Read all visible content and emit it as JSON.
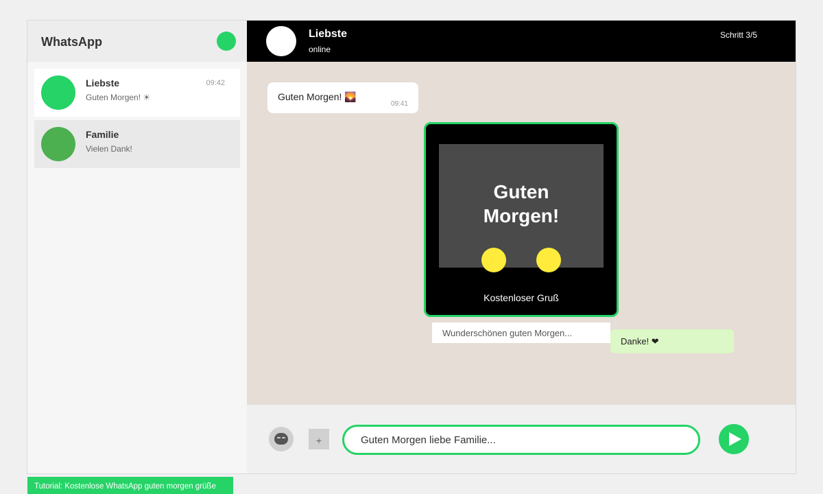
{
  "colors": {
    "accent": "#25d366",
    "header_bg": "#000000",
    "chat_bg": "#e5ddd6",
    "outgoing_bubble": "#dcf8c6",
    "card_inner": "#4a4a4a",
    "dot": "#ffeb3b",
    "avatar_familie": "#4caf50"
  },
  "sidebar": {
    "title": "WhatsApp",
    "chats": [
      {
        "name": "Liebste",
        "preview": "Guten Morgen! ☀",
        "time": "09:42",
        "avatar_color": "#25d366"
      },
      {
        "name": "Familie",
        "preview": "Vielen Dank!",
        "time": "",
        "avatar_color": "#4caf50"
      }
    ]
  },
  "header": {
    "name": "Liebste",
    "status": "online",
    "step": "Schritt 3/5"
  },
  "messages": {
    "incoming": {
      "text": "Guten Morgen! 🌄",
      "time": "09:41"
    },
    "card": {
      "title_line1": "Guten",
      "title_line2": "Morgen!",
      "caption": "Kostenloser Gruß"
    },
    "card_caption_text": "Wunderschönen guten Morgen...",
    "outgoing": "Danke! ❤"
  },
  "composer": {
    "value": "Guten Morgen liebe Familie...",
    "attach_label": "+",
    "emoji_icon": "emoji-icon",
    "send_icon": "send-icon"
  },
  "footer": {
    "tutorial": "Tutorial: Kostenlose WhatsApp guten morgen grüße"
  }
}
